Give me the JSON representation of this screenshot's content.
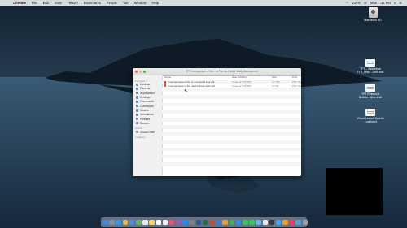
{
  "menubar": {
    "app_name": "Chrome",
    "items": [
      "File",
      "Edit",
      "View",
      "History",
      "Bookmarks",
      "People",
      "Tab",
      "Window",
      "Help"
    ],
    "battery": "100%",
    "clock": "Mon 7:42 PM"
  },
  "desktop_icons": [
    {
      "label": "Macintosh HD",
      "icon": "hard-drive-icon"
    },
    {
      "label": "TPT – Basketball FTS_Pract...Drm.mdx",
      "icon": "document-icon"
    },
    {
      "label": "TPT Resource Bulletin...Quiz.indd",
      "icon": "document-icon"
    },
    {
      "label": "Virtual Lesson Bulletin ...odd.mp4",
      "icon": "document-icon"
    }
  ],
  "finder": {
    "title": "TPT Comparison of Nu... & Fitness Factor Body Assessment",
    "sidebar": {
      "favorites_heading": "Favorites",
      "favorites": [
        "Desktop",
        "Recents",
        "Applications",
        "Desktop",
        "Documents",
        "Downloads",
        "Movies",
        "Animations",
        "Pictures",
        "Bowers"
      ],
      "icloud_heading": "iCloud",
      "icloud": [
        "iCloud Drive"
      ],
      "locations_heading": "Locations"
    },
    "columns": {
      "name": "Name",
      "date": "Date Modified",
      "size": "Size",
      "kind": "Kind"
    },
    "files": [
      {
        "name": "6 Components of Fit...ic and Quiz Links.pdf",
        "date": "Today at 6:48 PM",
        "size": "2.1 MB",
        "kind": "PDF Doc"
      },
      {
        "name": "6 Components of Fit...ated Fitness Quiz.pdf",
        "date": "Today at 6:48 PM",
        "size": "97 KB",
        "kind": "PDF Doc"
      }
    ]
  },
  "colors": {
    "sky": "#1e3447",
    "water": "#2d4b64",
    "traffic_red": "#fe5f57",
    "traffic_yellow": "#febb2e",
    "traffic_green": "#29c840"
  },
  "dock_icons": [
    "finder-icon",
    "launchpad-icon",
    "safari-icon",
    "chrome-icon",
    "mail-icon",
    "maps-icon",
    "photos-icon",
    "notes-icon",
    "calendar-icon",
    "reminders-icon",
    "music-icon",
    "podcasts-icon",
    "app-store-icon",
    "system-preferences-icon",
    "word-icon",
    "excel-icon",
    "powerpoint-icon",
    "keynote-icon",
    "pages-icon",
    "numbers-icon",
    "zoom-icon",
    "messages-icon",
    "facetime-icon",
    "preview-icon",
    "textedit-icon",
    "quicktime-icon",
    "photoshop-icon",
    "illustrator-icon",
    "indesign-icon",
    "downloads-folder-icon",
    "trash-icon"
  ]
}
